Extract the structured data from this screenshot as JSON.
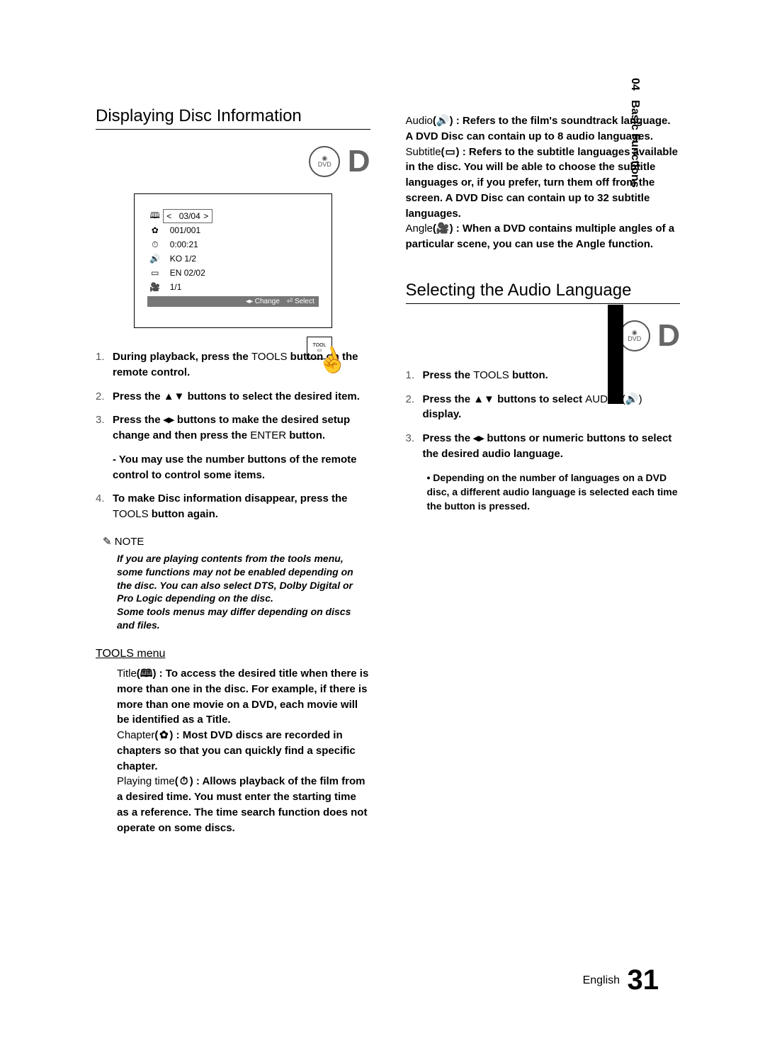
{
  "side": {
    "chapter_num": "04",
    "chapter_label": "Basic Functions"
  },
  "left": {
    "heading": "Displaying Disc Information",
    "dvd_badge": "DVD",
    "d_letter": "D",
    "osd": {
      "rows": [
        {
          "icon": "🕮",
          "value": "03/04",
          "top": true
        },
        {
          "icon": "✿",
          "value": "001/001"
        },
        {
          "icon": "⏱",
          "value": "0:00:21"
        },
        {
          "icon": "🔊",
          "value": "KO 1/2"
        },
        {
          "icon": "▭",
          "value": "EN 02/02"
        },
        {
          "icon": "🎥",
          "value": "1/1"
        }
      ],
      "foot_change": "◂▸ Change",
      "foot_select": "⏎ Select"
    },
    "remote_label": "TOOL",
    "steps": [
      {
        "n": "1.",
        "pre": "During playback, press the ",
        "btn": "TOOLS",
        "post": " button on the remote control."
      },
      {
        "n": "2.",
        "pre": "Press the ▲▼ buttons to select the desired item.",
        "btn": "",
        "post": ""
      },
      {
        "n": "3.",
        "pre": "Press the ◂▸ buttons to make the desired setup change and then press the ",
        "btn": "ENTER",
        "post": " button."
      },
      {
        "n": "",
        "pre": "- You may use the number buttons of the remote control to control some items.",
        "btn": "",
        "post": ""
      },
      {
        "n": "4.",
        "pre": "To make Disc information disappear, press the ",
        "btn": "TOOLS",
        "post": " button again."
      }
    ],
    "note_label": "✎ NOTE",
    "note_body": "If you are playing contents from the tools menu, some functions may not be enabled depending on the disc. You can also select DTS, Dolby Digital or Pro Logic depending on the disc.\nSome tools menus may differ depending on discs and files.",
    "tools_menu_h": "TOOLS menu",
    "tools_items": [
      {
        "term": "Title",
        "icon": "🕮",
        "desc": " : To access the desired title when there is more than one in the disc. For example, if there is more than one movie on a DVD, each movie will be identified as a Title."
      },
      {
        "term": "Chapter",
        "icon": "✿",
        "desc": " : Most DVD discs are recorded in chapters so that you can quickly find a specific chapter."
      },
      {
        "term": "Playing time",
        "icon": "⏱",
        "desc": " : Allows playback of the film from a desired time. You must enter the starting time as a reference. The time search function does not operate on some discs."
      }
    ]
  },
  "right": {
    "tools_items": [
      {
        "term": "Audio",
        "icon": "🔊",
        "desc": " : Refers to the film's soundtrack language. A DVD Disc can contain up to 8 audio languages."
      },
      {
        "term": "Subtitle",
        "icon": "▭",
        "desc": " : Refers to the subtitle languages available in the disc. You will be able to choose the subtitle languages or, if you prefer, turn them off from the screen. A DVD Disc can contain up to 32 subtitle languages."
      },
      {
        "term": "Angle",
        "icon": "🎥",
        "desc": " : When a DVD contains multiple angles of a particular scene, you can use the Angle function."
      }
    ],
    "heading2": "Selecting the Audio Language",
    "dvd_badge": "DVD",
    "d_letter": "D",
    "steps": [
      {
        "n": "1.",
        "pre": "Press the ",
        "btn": "TOOLS",
        "post": " button."
      },
      {
        "n": "2.",
        "pre": "Press the ▲▼ buttons to select ",
        "btn": "AUDIO (🔊)",
        "post": " display."
      },
      {
        "n": "3.",
        "pre": "Press the ◂▸ buttons or numeric buttons to select the desired audio language.",
        "btn": "",
        "post": ""
      }
    ],
    "sub_note": "• Depending on the number of languages on a DVD disc, a different audio language is selected each time the button is pressed."
  },
  "footer": {
    "lang": "English",
    "page": "31"
  }
}
